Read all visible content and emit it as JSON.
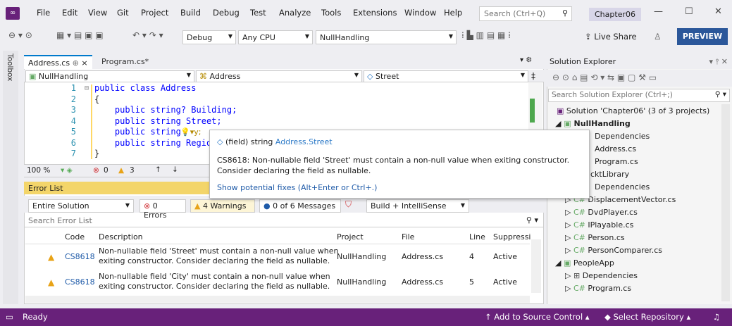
{
  "menubar": {
    "items": [
      "File",
      "Edit",
      "View",
      "Git",
      "Project",
      "Build",
      "Debug",
      "Test",
      "Analyze",
      "Tools",
      "Extensions",
      "Window",
      "Help"
    ],
    "search_placeholder": "Search (Ctrl+Q)",
    "solution_name": "Chapter06"
  },
  "toolbar": {
    "config": "Debug",
    "platform": "Any CPU",
    "startup": "NullHandling",
    "live_share": "Live Share",
    "preview": "PREVIEW"
  },
  "toolbox": {
    "label": "Toolbox"
  },
  "editor": {
    "tabs": [
      {
        "label": "Address.cs",
        "pinned": "⊕",
        "close": "×"
      },
      {
        "label": "Program.cs*"
      }
    ],
    "nav": {
      "project": "NullHandling",
      "class": "Address",
      "member": "Street"
    },
    "lines": [
      {
        "n": "1",
        "text": "public class Address"
      },
      {
        "n": "2",
        "text": "{"
      },
      {
        "n": "3",
        "text": "    public string? Building;"
      },
      {
        "n": "4",
        "text": "    public string Street;"
      },
      {
        "n": "5",
        "text": "    public string"
      },
      {
        "n": "6",
        "text": "    public string Regio"
      },
      {
        "n": "7",
        "text": "}"
      }
    ],
    "zoom": "100 %",
    "errors": "0",
    "warnings": "3"
  },
  "tooltip": {
    "sig_prefix": "(field) string ",
    "sig_member": "Address.Street",
    "message": "CS8618: Non-nullable field 'Street' must contain a non-null value when exiting constructor. Consider declaring the field as nullable.",
    "fixes": "Show potential fixes (Alt+Enter or Ctrl+.)"
  },
  "errorlist": {
    "title": "Error List",
    "scope": "Entire Solution",
    "errors": "0 Errors",
    "warnings": "4 Warnings",
    "messages": "0 of 6 Messages",
    "build": "Build + IntelliSense",
    "search": "Search Error List",
    "headers": [
      "Code",
      "Description",
      "Project",
      "File",
      "Line",
      "Suppressi"
    ],
    "rows": [
      {
        "code": "CS8618",
        "desc1": "Non-nullable field 'Street' must contain a non-null value when",
        "desc2": "exiting constructor. Consider declaring the field as nullable.",
        "project": "NullHandling",
        "file": "Address.cs",
        "line": "4",
        "supp": "Active"
      },
      {
        "code": "CS8618",
        "desc1": "Non-nullable field 'City' must contain a non-null value when",
        "desc2": "exiting constructor. Consider declaring the field as nullable.",
        "project": "NullHandling",
        "file": "Address.cs",
        "line": "5",
        "supp": "Active"
      }
    ]
  },
  "solution": {
    "title": "Solution Explorer",
    "search": "Search Solution Explorer (Ctrl+;)",
    "items": [
      {
        "t": "Solution 'Chapter06' (3 of 3 projects)"
      },
      {
        "t": "NullHandling"
      },
      {
        "t": "Dependencies"
      },
      {
        "t": "Address.cs"
      },
      {
        "t": "Program.cs"
      },
      {
        "t": "cktLibrary"
      },
      {
        "t": "Dependencies"
      },
      {
        "t": "DisplacementVector.cs"
      },
      {
        "t": "DvdPlayer.cs"
      },
      {
        "t": "IPlayable.cs"
      },
      {
        "t": "Person.cs"
      },
      {
        "t": "PersonComparer.cs"
      },
      {
        "t": "PeopleApp"
      },
      {
        "t": "Dependencies"
      },
      {
        "t": "Program.cs"
      }
    ]
  },
  "status": {
    "ready": "Ready",
    "source": "Add to Source Control",
    "repo": "Select Repository"
  }
}
